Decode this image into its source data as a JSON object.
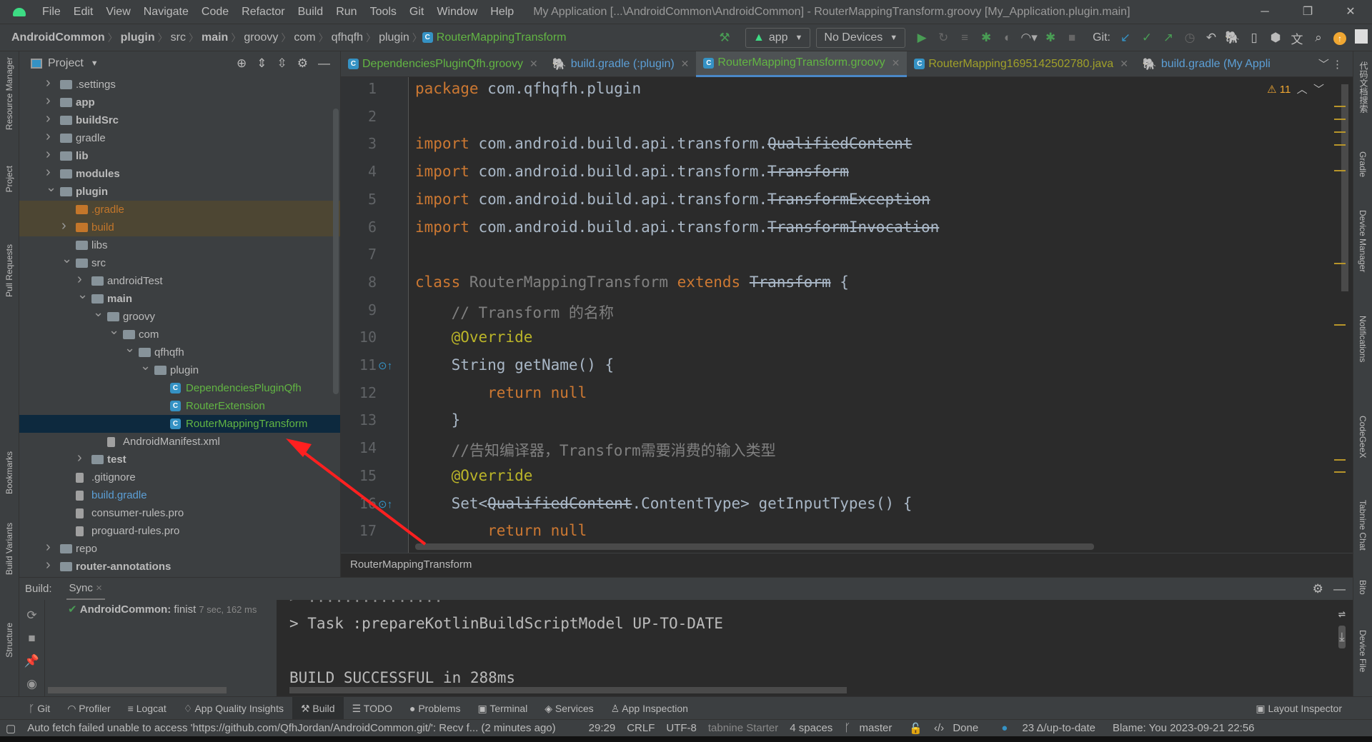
{
  "menubar": {
    "items": [
      "File",
      "Edit",
      "View",
      "Navigate",
      "Code",
      "Refactor",
      "Build",
      "Run",
      "Tools",
      "Git",
      "Window",
      "Help"
    ],
    "title": "My Application [...\\AndroidCommon\\AndroidCommon] - RouterMappingTransform.groovy [My_Application.plugin.main]"
  },
  "breadcrumb": [
    {
      "t": "AndroidCommon",
      "b": true
    },
    {
      "t": "plugin",
      "b": true
    },
    {
      "t": "src"
    },
    {
      "t": "main",
      "b": true
    },
    {
      "t": "groovy"
    },
    {
      "t": "com"
    },
    {
      "t": "qfhqfh"
    },
    {
      "t": "plugin"
    }
  ],
  "breadcrumb_file": "RouterMappingTransform",
  "toolbar": {
    "config": "app",
    "device": "No Devices",
    "git_label": "Git:"
  },
  "project": {
    "title": "Project",
    "tree": [
      {
        "label": ".settings",
        "level": 0,
        "arrow": "right",
        "icon": "folder"
      },
      {
        "label": "app",
        "level": 0,
        "arrow": "right",
        "icon": "folder",
        "bold": true
      },
      {
        "label": "buildSrc",
        "level": 0,
        "arrow": "right",
        "icon": "folder",
        "bold": true
      },
      {
        "label": "gradle",
        "level": 0,
        "arrow": "right",
        "icon": "folder"
      },
      {
        "label": "lib",
        "level": 0,
        "arrow": "right",
        "icon": "folder",
        "bold": true
      },
      {
        "label": "modules",
        "level": 0,
        "arrow": "right",
        "icon": "folder",
        "bold": true
      },
      {
        "label": "plugin",
        "level": 0,
        "arrow": "down",
        "icon": "folder",
        "bold": true
      },
      {
        "label": ".gradle",
        "level": 1,
        "icon": "ofolder",
        "color": "#c3762a",
        "hl": true
      },
      {
        "label": "build",
        "level": 1,
        "arrow": "right",
        "icon": "ofolder",
        "color": "#c3762a",
        "hl": true
      },
      {
        "label": "libs",
        "level": 1,
        "icon": "folder"
      },
      {
        "label": "src",
        "level": 1,
        "arrow": "down",
        "icon": "folder"
      },
      {
        "label": "androidTest",
        "level": 2,
        "arrow": "right",
        "icon": "folder"
      },
      {
        "label": "main",
        "level": 2,
        "arrow": "down",
        "icon": "folder",
        "bold": true
      },
      {
        "label": "groovy",
        "level": 3,
        "arrow": "down",
        "icon": "folder"
      },
      {
        "label": "com",
        "level": 4,
        "arrow": "down",
        "icon": "folder"
      },
      {
        "label": "qfhqfh",
        "level": 5,
        "arrow": "down",
        "icon": "folder"
      },
      {
        "label": "plugin",
        "level": 6,
        "arrow": "down",
        "icon": "folder"
      },
      {
        "label": "DependenciesPluginQfh",
        "level": 7,
        "icon": "cls",
        "color": "#62b543"
      },
      {
        "label": "RouterExtension",
        "level": 7,
        "icon": "cls",
        "color": "#62b543"
      },
      {
        "label": "RouterMappingTransform",
        "level": 7,
        "icon": "cls",
        "color": "#62b543",
        "sel": true
      },
      {
        "label": "AndroidManifest.xml",
        "level": 3,
        "icon": "file"
      },
      {
        "label": "test",
        "level": 2,
        "arrow": "right",
        "icon": "folder",
        "bold": true
      },
      {
        "label": ".gitignore",
        "level": 1,
        "icon": "file"
      },
      {
        "label": "build.gradle",
        "level": 1,
        "icon": "file",
        "color": "#5c9fd6"
      },
      {
        "label": "consumer-rules.pro",
        "level": 1,
        "icon": "file"
      },
      {
        "label": "proguard-rules.pro",
        "level": 1,
        "icon": "file"
      },
      {
        "label": "repo",
        "level": 0,
        "arrow": "right",
        "icon": "folder"
      },
      {
        "label": "router-annotations",
        "level": 0,
        "arrow": "right",
        "icon": "folder",
        "bold": true
      }
    ]
  },
  "tabs": [
    {
      "label": "DependenciesPluginQfh.groovy",
      "icon": "C",
      "color": "#62b543"
    },
    {
      "label": "build.gradle (:plugin)",
      "icon": "gradle",
      "color": "#5c9fd6"
    },
    {
      "label": "RouterMappingTransform.groovy",
      "icon": "C",
      "color": "#62b543",
      "active": true
    },
    {
      "label": "RouterMapping1695142502780.java",
      "icon": "C",
      "color": "#a0a029"
    },
    {
      "label": "build.gradle (My Appli",
      "icon": "gradle",
      "color": "#5c9fd6",
      "noclose": true
    }
  ],
  "editor": {
    "warnings": "⚠ 11",
    "breadcrumb": "RouterMappingTransform",
    "lines": [
      [
        [
          "k",
          "package "
        ],
        [
          "",
          "com.qfhqfh.plugin"
        ]
      ],
      [],
      [
        [
          "k",
          "import "
        ],
        [
          "",
          "com.android.build.api.transform."
        ],
        [
          "s",
          "QualifiedContent"
        ]
      ],
      [
        [
          "k",
          "import "
        ],
        [
          "",
          "com.android.build.api.transform."
        ],
        [
          "s",
          "Transform"
        ]
      ],
      [
        [
          "k",
          "import "
        ],
        [
          "",
          "com.android.build.api.transform."
        ],
        [
          "s",
          "TransformException"
        ]
      ],
      [
        [
          "k",
          "import "
        ],
        [
          "",
          "com.android.build.api.transform."
        ],
        [
          "s",
          "TransformInvocation"
        ]
      ],
      [],
      [
        [
          "k",
          "class "
        ],
        [
          "u",
          "RouterMappingTransform "
        ],
        [
          "k",
          "extends "
        ],
        [
          "s",
          "Transform"
        ],
        [
          "",
          " {"
        ]
      ],
      [
        [
          "c",
          "    // Transform 的名称"
        ]
      ],
      [
        [
          "a",
          "    @Override"
        ]
      ],
      [
        [
          "",
          "    String getName() {"
        ]
      ],
      [
        [
          "k",
          "        return null"
        ]
      ],
      [
        [
          "",
          "    }"
        ]
      ],
      [
        [
          "c",
          "    //告知编译器，Transform需要消费的输入类型"
        ]
      ],
      [
        [
          "a",
          "    @Override"
        ]
      ],
      [
        [
          "",
          "    Set<"
        ],
        [
          "s",
          "QualifiedContent"
        ],
        [
          "",
          ".ContentType> getInputTypes() {"
        ]
      ],
      [
        [
          "k",
          "        return null"
        ]
      ]
    ]
  },
  "build": {
    "label": "Build:",
    "tab": "Sync",
    "item": "AndroidCommon:",
    "item_status": "finist",
    "item_time": "7 sec, 162 ms",
    "console": [
      "> Task :prepareKotlinBuildScriptModel UP-TO-DATE",
      "",
      "BUILD SUCCESSFUL in 288ms"
    ]
  },
  "toolwindows": [
    "Git",
    "Profiler",
    "Logcat",
    "App Quality Insights",
    "Build",
    "TODO",
    "Problems",
    "Terminal",
    "Services",
    "App Inspection"
  ],
  "toolwindow_active": "Build",
  "layout_inspector": "Layout Inspector",
  "left_strip": [
    "Resource Manager",
    "Project",
    "Pull Requests",
    "Bookmarks",
    "Build Variants",
    "Structure"
  ],
  "right_strip": [
    "代码文档搜索",
    "Gradle",
    "Device Manager",
    "Notifications",
    "CodeGeeX",
    "Tabnine Chat",
    "Bito",
    "Device File"
  ],
  "status": {
    "message": "Auto fetch failed unable to access 'https://github.com/QfhJordan/AndroidCommon.git/': Recv f... (2 minutes ago)",
    "position": "29:29",
    "line_sep": "CRLF",
    "encoding": "UTF-8",
    "tabnine": "tabnine Starter",
    "indent": "4 spaces",
    "branch": "master",
    "done": "Done",
    "updates": "23 Δ/up-to-date",
    "blame": "Blame: You 2023-09-21 22:56"
  },
  "colors": {
    "accent": "#4a88c7",
    "keyword": "#cc7832",
    "annotation": "#bbb529",
    "comment": "#808080",
    "arrow": "#ff2020"
  }
}
